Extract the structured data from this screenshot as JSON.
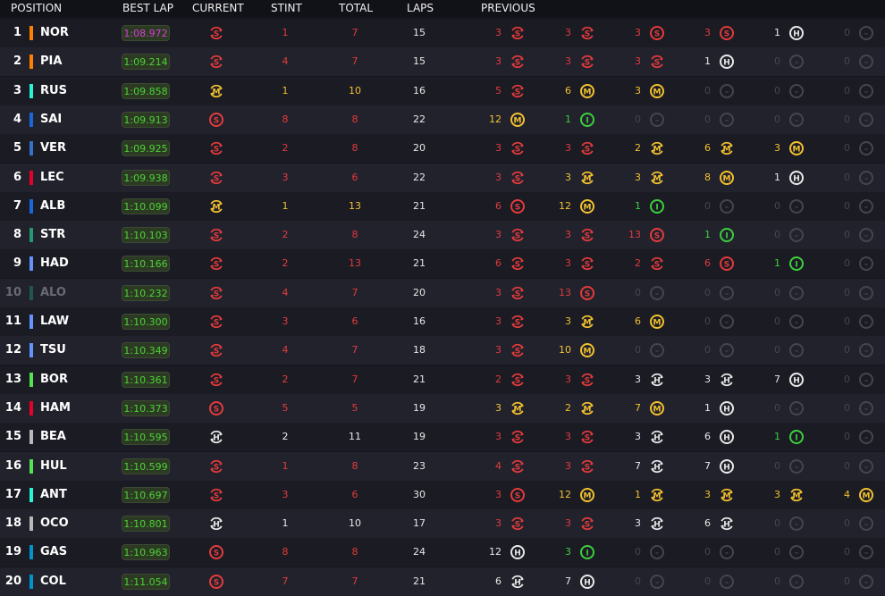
{
  "header": {
    "position": "POSITION",
    "best_lap": "BEST LAP",
    "current": "CURRENT",
    "stint": "STINT",
    "total": "TOTAL",
    "laps": "LAPS",
    "previous": "PREVIOUS"
  },
  "team_colors": {
    "mclaren": "#ff8000",
    "mercedes": "#27f4d2",
    "williams": "#1868db",
    "red_bull": "#3671c6",
    "ferrari": "#e8002d",
    "aston_martin": "#229971",
    "racing_bulls": "#6692ff",
    "sauber": "#52e252",
    "haas": "#b6babd",
    "alpine": "#0093cc"
  },
  "compound_colors": {
    "S": "#e23b3b",
    "M": "#f2c12e",
    "H": "#e8e8e8",
    "I": "#3ccf3c",
    "-": "#45454f"
  },
  "rows": [
    {
      "pos": "1",
      "team": "mclaren",
      "driver": "NOR",
      "best": "1:08.972",
      "fastest": true,
      "current": {
        "c": "S",
        "n": true
      },
      "stint": "1",
      "total": "7",
      "laps": "15",
      "prev": [
        [
          "3",
          "S",
          true
        ],
        [
          "3",
          "S",
          true
        ],
        [
          "3",
          "S",
          false
        ],
        [
          "3",
          "S",
          false
        ],
        [
          "1",
          "H",
          false
        ],
        [
          "0",
          "-",
          false
        ]
      ]
    },
    {
      "pos": "2",
      "team": "mclaren",
      "driver": "PIA",
      "best": "1:09.214",
      "current": {
        "c": "S",
        "n": true
      },
      "stint": "4",
      "total": "7",
      "laps": "15",
      "prev": [
        [
          "3",
          "S",
          true
        ],
        [
          "3",
          "S",
          true
        ],
        [
          "3",
          "S",
          true
        ],
        [
          "1",
          "H",
          false
        ],
        [
          "0",
          "-",
          false
        ],
        [
          "0",
          "-",
          false
        ]
      ]
    },
    {
      "pos": "3",
      "team": "mercedes",
      "driver": "RUS",
      "best": "1:09.858",
      "current": {
        "c": "M",
        "n": true
      },
      "stint": "1",
      "total": "10",
      "laps": "16",
      "prev": [
        [
          "5",
          "S",
          true
        ],
        [
          "6",
          "M",
          false
        ],
        [
          "3",
          "M",
          false
        ],
        [
          "0",
          "-",
          false
        ],
        [
          "0",
          "-",
          false
        ],
        [
          "0",
          "-",
          false
        ]
      ]
    },
    {
      "pos": "4",
      "team": "williams",
      "driver": "SAI",
      "best": "1:09.913",
      "current": {
        "c": "S",
        "n": false
      },
      "stint": "8",
      "total": "8",
      "laps": "22",
      "prev": [
        [
          "12",
          "M",
          false
        ],
        [
          "1",
          "I",
          false
        ],
        [
          "0",
          "-",
          false
        ],
        [
          "0",
          "-",
          false
        ],
        [
          "0",
          "-",
          false
        ],
        [
          "0",
          "-",
          false
        ]
      ]
    },
    {
      "pos": "5",
      "team": "red_bull",
      "driver": "VER",
      "best": "1:09.925",
      "current": {
        "c": "S",
        "n": true
      },
      "stint": "2",
      "total": "8",
      "laps": "20",
      "prev": [
        [
          "3",
          "S",
          true
        ],
        [
          "3",
          "S",
          true
        ],
        [
          "2",
          "M",
          true
        ],
        [
          "6",
          "M",
          true
        ],
        [
          "3",
          "M",
          false
        ],
        [
          "0",
          "-",
          false
        ]
      ]
    },
    {
      "pos": "6",
      "team": "ferrari",
      "driver": "LEC",
      "best": "1:09.938",
      "current": {
        "c": "S",
        "n": true
      },
      "stint": "3",
      "total": "6",
      "laps": "22",
      "prev": [
        [
          "3",
          "S",
          true
        ],
        [
          "3",
          "M",
          true
        ],
        [
          "3",
          "M",
          true
        ],
        [
          "8",
          "M",
          false
        ],
        [
          "1",
          "H",
          false
        ],
        [
          "0",
          "-",
          false
        ]
      ]
    },
    {
      "pos": "7",
      "team": "williams",
      "driver": "ALB",
      "best": "1:10.099",
      "current": {
        "c": "M",
        "n": true
      },
      "stint": "1",
      "total": "13",
      "laps": "21",
      "prev": [
        [
          "6",
          "S",
          false
        ],
        [
          "12",
          "M",
          false
        ],
        [
          "1",
          "I",
          false
        ],
        [
          "0",
          "-",
          false
        ],
        [
          "0",
          "-",
          false
        ],
        [
          "0",
          "-",
          false
        ]
      ]
    },
    {
      "pos": "8",
      "team": "aston_martin",
      "driver": "STR",
      "best": "1:10.103",
      "current": {
        "c": "S",
        "n": true
      },
      "stint": "2",
      "total": "8",
      "laps": "24",
      "prev": [
        [
          "3",
          "S",
          true
        ],
        [
          "3",
          "S",
          true
        ],
        [
          "13",
          "S",
          false
        ],
        [
          "1",
          "I",
          false
        ],
        [
          "0",
          "-",
          false
        ],
        [
          "0",
          "-",
          false
        ]
      ]
    },
    {
      "pos": "9",
      "team": "racing_bulls",
      "driver": "HAD",
      "best": "1:10.166",
      "current": {
        "c": "S",
        "n": true
      },
      "stint": "2",
      "total": "13",
      "laps": "21",
      "prev": [
        [
          "6",
          "S",
          true
        ],
        [
          "3",
          "S",
          true
        ],
        [
          "2",
          "S",
          true
        ],
        [
          "6",
          "S",
          false
        ],
        [
          "1",
          "I",
          false
        ],
        [
          "0",
          "-",
          false
        ]
      ]
    },
    {
      "pos": "10",
      "team": "aston_martin",
      "driver": "ALO",
      "best": "1:10.232",
      "dim": true,
      "current": {
        "c": "S",
        "n": true
      },
      "stint": "4",
      "total": "7",
      "laps": "20",
      "prev": [
        [
          "3",
          "S",
          true
        ],
        [
          "13",
          "S",
          false
        ],
        [
          "0",
          "-",
          false
        ],
        [
          "0",
          "-",
          false
        ],
        [
          "0",
          "-",
          false
        ],
        [
          "0",
          "-",
          false
        ]
      ]
    },
    {
      "pos": "11",
      "team": "racing_bulls",
      "driver": "LAW",
      "best": "1:10.300",
      "current": {
        "c": "S",
        "n": true
      },
      "stint": "3",
      "total": "6",
      "laps": "16",
      "prev": [
        [
          "3",
          "S",
          true
        ],
        [
          "3",
          "M",
          true
        ],
        [
          "6",
          "M",
          false
        ],
        [
          "0",
          "-",
          false
        ],
        [
          "0",
          "-",
          false
        ],
        [
          "0",
          "-",
          false
        ]
      ]
    },
    {
      "pos": "12",
      "team": "racing_bulls",
      "driver": "TSU",
      "best": "1:10.349",
      "current": {
        "c": "S",
        "n": true
      },
      "stint": "4",
      "total": "7",
      "laps": "18",
      "prev": [
        [
          "3",
          "S",
          true
        ],
        [
          "10",
          "M",
          false
        ],
        [
          "0",
          "-",
          false
        ],
        [
          "0",
          "-",
          false
        ],
        [
          "0",
          "-",
          false
        ],
        [
          "0",
          "-",
          false
        ]
      ]
    },
    {
      "pos": "13",
      "team": "sauber",
      "driver": "BOR",
      "best": "1:10.361",
      "current": {
        "c": "S",
        "n": true
      },
      "stint": "2",
      "total": "7",
      "laps": "21",
      "prev": [
        [
          "2",
          "S",
          true
        ],
        [
          "3",
          "S",
          true
        ],
        [
          "3",
          "H",
          true
        ],
        [
          "3",
          "H",
          true
        ],
        [
          "7",
          "H",
          false
        ],
        [
          "0",
          "-",
          false
        ]
      ]
    },
    {
      "pos": "14",
      "team": "ferrari",
      "driver": "HAM",
      "best": "1:10.373",
      "current": {
        "c": "S",
        "n": false
      },
      "stint": "5",
      "total": "5",
      "laps": "19",
      "prev": [
        [
          "3",
          "M",
          true
        ],
        [
          "2",
          "M",
          true
        ],
        [
          "7",
          "M",
          false
        ],
        [
          "1",
          "H",
          false
        ],
        [
          "0",
          "-",
          false
        ],
        [
          "0",
          "-",
          false
        ]
      ]
    },
    {
      "pos": "15",
      "team": "haas",
      "driver": "BEA",
      "best": "1:10.595",
      "current": {
        "c": "H",
        "n": true
      },
      "stint": "2",
      "total": "11",
      "laps": "19",
      "prev": [
        [
          "3",
          "S",
          true
        ],
        [
          "3",
          "S",
          true
        ],
        [
          "3",
          "H",
          true
        ],
        [
          "6",
          "H",
          false
        ],
        [
          "1",
          "I",
          false
        ],
        [
          "0",
          "-",
          false
        ]
      ]
    },
    {
      "pos": "16",
      "team": "sauber",
      "driver": "HUL",
      "best": "1:10.599",
      "current": {
        "c": "S",
        "n": true
      },
      "stint": "1",
      "total": "8",
      "laps": "23",
      "prev": [
        [
          "4",
          "S",
          true
        ],
        [
          "3",
          "S",
          true
        ],
        [
          "7",
          "H",
          true
        ],
        [
          "7",
          "H",
          false
        ],
        [
          "0",
          "-",
          false
        ],
        [
          "0",
          "-",
          false
        ]
      ]
    },
    {
      "pos": "17",
      "team": "mercedes",
      "driver": "ANT",
      "best": "1:10.697",
      "current": {
        "c": "S",
        "n": true
      },
      "stint": "3",
      "total": "6",
      "laps": "30",
      "prev": [
        [
          "3",
          "S",
          false
        ],
        [
          "12",
          "M",
          false
        ],
        [
          "1",
          "M",
          true
        ],
        [
          "3",
          "M",
          true
        ],
        [
          "3",
          "M",
          true
        ],
        [
          "4",
          "M",
          false
        ]
      ]
    },
    {
      "pos": "18",
      "team": "haas",
      "driver": "OCO",
      "best": "1:10.801",
      "current": {
        "c": "H",
        "n": true
      },
      "stint": "1",
      "total": "10",
      "laps": "17",
      "prev": [
        [
          "3",
          "S",
          true
        ],
        [
          "3",
          "S",
          true
        ],
        [
          "3",
          "H",
          true
        ],
        [
          "6",
          "H",
          true
        ],
        [
          "0",
          "-",
          false
        ],
        [
          "0",
          "-",
          false
        ]
      ]
    },
    {
      "pos": "19",
      "team": "alpine",
      "driver": "GAS",
      "best": "1:10.963",
      "current": {
        "c": "S",
        "n": false
      },
      "stint": "8",
      "total": "8",
      "laps": "24",
      "prev": [
        [
          "12",
          "H",
          false
        ],
        [
          "3",
          "I",
          false
        ],
        [
          "0",
          "-",
          false
        ],
        [
          "0",
          "-",
          false
        ],
        [
          "0",
          "-",
          false
        ],
        [
          "0",
          "-",
          false
        ]
      ]
    },
    {
      "pos": "20",
      "team": "alpine",
      "driver": "COL",
      "best": "1:11.054",
      "current": {
        "c": "S",
        "n": false
      },
      "stint": "7",
      "total": "7",
      "laps": "21",
      "prev": [
        [
          "6",
          "H",
          true
        ],
        [
          "7",
          "H",
          false
        ],
        [
          "0",
          "-",
          false
        ],
        [
          "0",
          "-",
          false
        ],
        [
          "0",
          "-",
          false
        ],
        [
          "0",
          "-",
          false
        ]
      ]
    }
  ]
}
